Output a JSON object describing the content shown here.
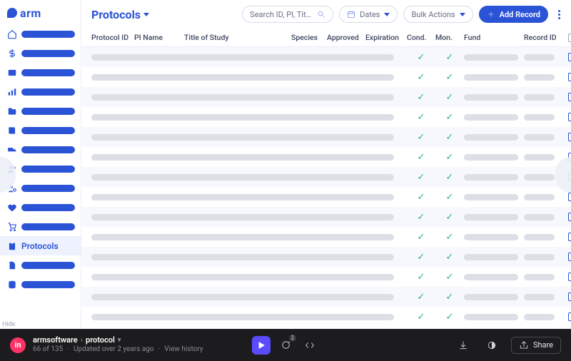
{
  "brand": {
    "name": "arm"
  },
  "sidebar": {
    "items": [
      {
        "icon": "home"
      },
      {
        "icon": "dollar"
      },
      {
        "icon": "id-card"
      },
      {
        "icon": "chart-bar"
      },
      {
        "icon": "folder"
      },
      {
        "icon": "book"
      },
      {
        "icon": "truck"
      },
      {
        "icon": "users"
      },
      {
        "icon": "user-cog"
      },
      {
        "icon": "heart"
      },
      {
        "icon": "cart"
      },
      {
        "icon": "clipboard",
        "label": "Protocols",
        "active": true
      },
      {
        "icon": "file"
      },
      {
        "icon": "database"
      }
    ]
  },
  "header": {
    "title": "Protocols",
    "search_placeholder": "Search ID, PI, Title...",
    "dates_label": "Dates",
    "bulk_label": "Bulk Actions",
    "add_label": "Add Record"
  },
  "table": {
    "columns": [
      "Protocol ID",
      "PI Name",
      "Title of Study",
      "Species",
      "Approved",
      "Expiration",
      "Cond.",
      "Mon.",
      "Fund",
      "Record ID"
    ],
    "rows": [
      {
        "cond": true,
        "mon": true
      },
      {
        "cond": true,
        "mon": true
      },
      {
        "cond": true,
        "mon": true
      },
      {
        "cond": true,
        "mon": true
      },
      {
        "cond": true,
        "mon": true
      },
      {
        "cond": true,
        "mon": true
      },
      {
        "cond": true,
        "mon": true
      },
      {
        "cond": true,
        "mon": true
      },
      {
        "cond": true,
        "mon": true
      },
      {
        "cond": true,
        "mon": true
      },
      {
        "cond": true,
        "mon": true
      },
      {
        "cond": true,
        "mon": true
      },
      {
        "cond": true,
        "mon": true
      },
      {
        "cond": true,
        "mon": true
      }
    ]
  },
  "hide_label": "Hide",
  "invision": {
    "project": "armsoftware",
    "screen": "protocol",
    "position": "66 of 135",
    "updated": "Updated over 2 years ago",
    "history": "View history",
    "comment_count": "2",
    "share": "Share"
  }
}
